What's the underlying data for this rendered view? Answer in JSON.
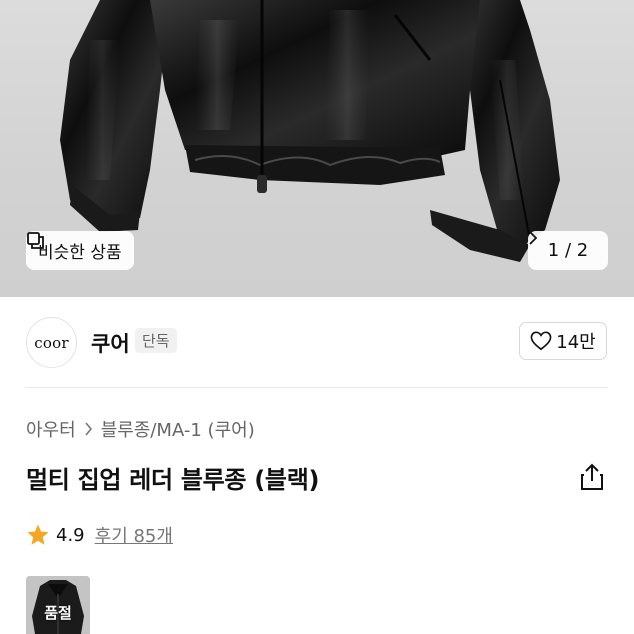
{
  "gallery": {
    "similar_label": "비슷한 상품",
    "pager_text": "1 / 2"
  },
  "brand": {
    "logo_text": "coor",
    "name": "쿠어",
    "badge": "단독",
    "like_count": "14만"
  },
  "breadcrumb": {
    "items": [
      "아우터",
      "블루종/MA-1 (쿠어)"
    ]
  },
  "product": {
    "title": "멀티 집업 레더 블루종 (블랙)"
  },
  "rating": {
    "score": "4.9",
    "reviews": "후기 85개"
  },
  "thumbnail": {
    "label": "품절"
  },
  "icons": {
    "similar": "copy-icon",
    "pager_next": "chevron-right-icon",
    "like": "heart-icon",
    "breadcrumb_sep": "chevron-right-icon",
    "share": "share-icon",
    "star": "star-icon"
  },
  "colors": {
    "star": "#F5A623",
    "text_primary": "#111111",
    "text_secondary": "#666666"
  }
}
